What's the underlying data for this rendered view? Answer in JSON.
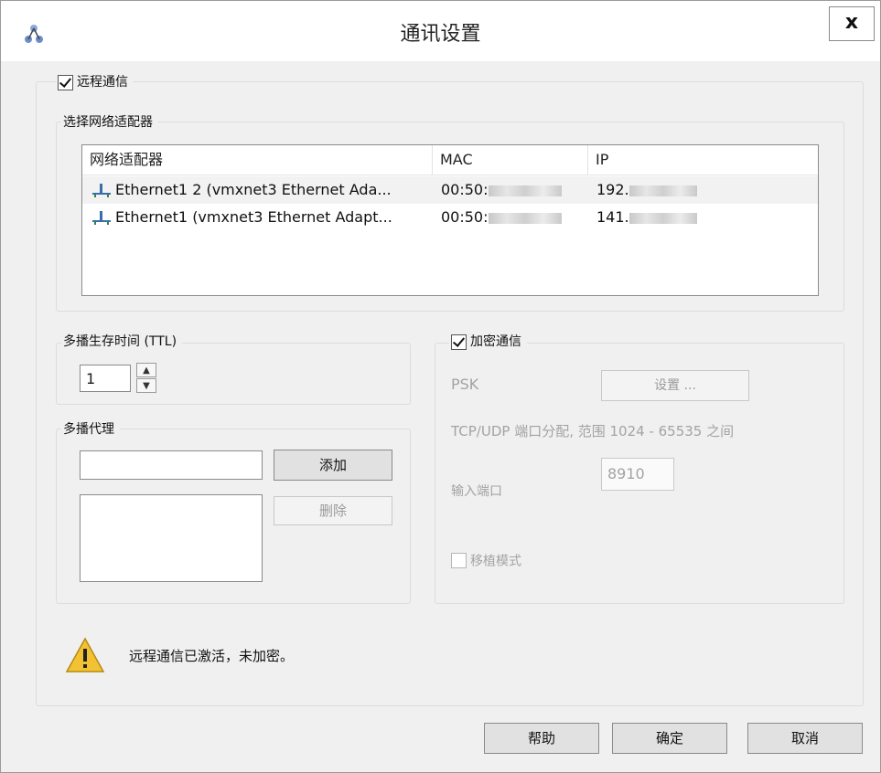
{
  "window": {
    "title": "通讯设置",
    "close_label": "x"
  },
  "remote": {
    "label": "远程通信",
    "checked": true
  },
  "adapters": {
    "group_label": "选择网络适配器",
    "columns": [
      "网络适配器",
      "MAC",
      "IP"
    ],
    "rows": [
      {
        "name": "Ethernet1 2 (vmxnet3 Ethernet Ada...",
        "mac": "00:50:",
        "ip": "192."
      },
      {
        "name": "Ethernet1 (vmxnet3 Ethernet Adapt...",
        "mac": "00:50:",
        "ip": "141."
      }
    ]
  },
  "ttl": {
    "group_label": "多播生存时间 (TTL)",
    "value": "1",
    "up_icon": "chevron-up-icon",
    "down_icon": "chevron-down-icon"
  },
  "proxy": {
    "group_label": "多播代理",
    "add_label": "添加",
    "delete_label": "删除"
  },
  "encryption": {
    "label": "加密通信",
    "checked": true,
    "psk_label": "PSK",
    "settings_label": "设置 ...",
    "port_range_text": "TCP/UDP 端口分配, 范围 1024 - 65535 之间",
    "input_port_label": "输入端口",
    "port_value": "8910",
    "portable_label": "移植模式",
    "portable_checked": false
  },
  "status": {
    "icon": "warning-icon",
    "text": "远程通信已激活，未加密。"
  },
  "buttons": {
    "help": "帮助",
    "ok": "确定",
    "cancel": "取消"
  }
}
